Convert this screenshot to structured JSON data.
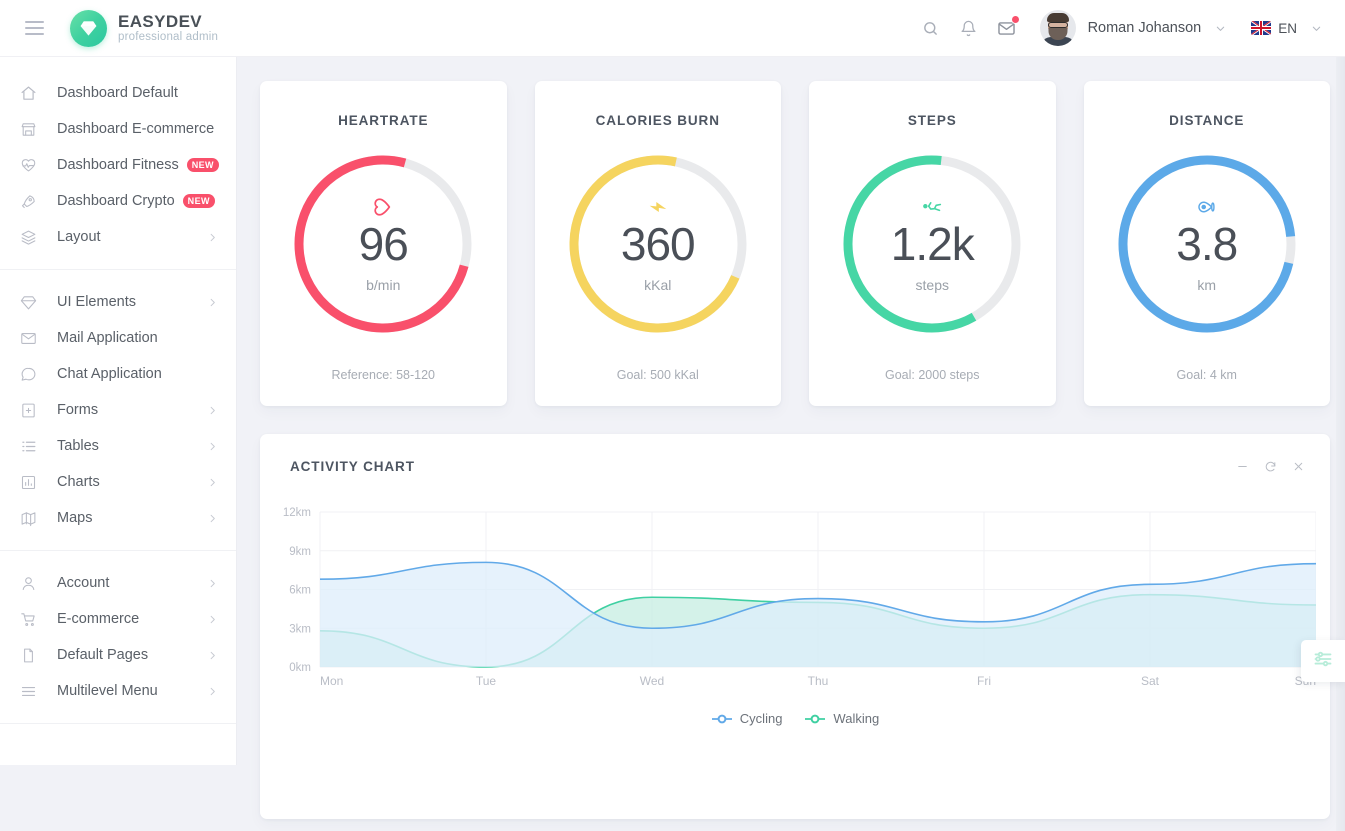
{
  "header": {
    "menu_icon": "hamburger-icon",
    "logo_icon": "diamond-icon",
    "logo_title": "EASYDEV",
    "logo_subtitle": "professional admin",
    "search_icon": "search-icon",
    "bell_icon": "bell-icon",
    "mail_icon": "envelope-icon",
    "user_name": "Roman Johanson",
    "user_chevron": "chevron-down-icon",
    "language": "EN",
    "lang_chevron": "chevron-down-icon",
    "flag": "uk-flag-icon"
  },
  "sidebar": {
    "groups": [
      {
        "items": [
          {
            "label": "Dashboard Default",
            "icon": "home-icon",
            "badge": null,
            "arrow": false
          },
          {
            "label": "Dashboard E-commerce",
            "icon": "store-icon",
            "badge": null,
            "arrow": false
          },
          {
            "label": "Dashboard Fitness",
            "icon": "heart-pulse-icon",
            "badge": "NEW",
            "arrow": false
          },
          {
            "label": "Dashboard Crypto",
            "icon": "rocket-icon",
            "badge": "NEW",
            "arrow": false
          },
          {
            "label": "Layout",
            "icon": "layers-icon",
            "badge": null,
            "arrow": true
          }
        ]
      },
      {
        "items": [
          {
            "label": "UI Elements",
            "icon": "diamond-icon",
            "badge": null,
            "arrow": true
          },
          {
            "label": "Mail Application",
            "icon": "envelope-icon",
            "badge": null,
            "arrow": false
          },
          {
            "label": "Chat Application",
            "icon": "chat-icon",
            "badge": null,
            "arrow": false
          },
          {
            "label": "Forms",
            "icon": "form-icon",
            "badge": null,
            "arrow": true
          },
          {
            "label": "Tables",
            "icon": "list-icon",
            "badge": null,
            "arrow": true
          },
          {
            "label": "Charts",
            "icon": "bar-chart-icon",
            "badge": null,
            "arrow": true
          },
          {
            "label": "Maps",
            "icon": "map-icon",
            "badge": null,
            "arrow": true
          }
        ]
      },
      {
        "items": [
          {
            "label": "Default Pages",
            "icon": "file-icon",
            "badge": null,
            "arrow": true
          },
          {
            "label": "Multilevel Menu",
            "icon": "menu-icon",
            "badge": null,
            "arrow": true
          }
        ]
      }
    ],
    "group3_pre": [
      {
        "label": "Account",
        "icon": "user-icon",
        "badge": null,
        "arrow": true
      },
      {
        "label": "E-commerce",
        "icon": "cart-icon",
        "badge": null,
        "arrow": true
      }
    ]
  },
  "stats": [
    {
      "title": "HEARTRATE",
      "value": "96",
      "unit": "b/min",
      "footer": "Reference: 58-120",
      "icon": "heart-icon",
      "color": "#f9506b",
      "track": "#e9eaec",
      "percent": 75
    },
    {
      "title": "CALORIES BURN",
      "value": "360",
      "unit": "kKal",
      "footer": "Goal: 500 kKal",
      "icon": "bolt-icon",
      "color": "#f5d45f",
      "track": "#e9eaec",
      "percent": 72
    },
    {
      "title": "STEPS",
      "value": "1.2k",
      "unit": "steps",
      "footer": "Goal: 2000 steps",
      "icon": "walk-icon",
      "color": "#46d6a5",
      "track": "#e9eaec",
      "percent": 60
    },
    {
      "title": "DISTANCE",
      "value": "3.8",
      "unit": "km",
      "footer": "Goal: 4 km",
      "icon": "pin-icon",
      "color": "#5ca9e8",
      "track": "#e9eaec",
      "percent": 95
    }
  ],
  "chart_panel": {
    "title": "ACTIVITY CHART",
    "minimize_icon": "minus-icon",
    "refresh_icon": "refresh-icon",
    "close_icon": "close-icon"
  },
  "chart_data": {
    "type": "area",
    "title": "ACTIVITY CHART",
    "xlabel": "",
    "ylabel": "",
    "categories": [
      "Mon",
      "Tue",
      "Wed",
      "Thu",
      "Fri",
      "Sat",
      "Sun"
    ],
    "ytick_labels": [
      "0km",
      "3km",
      "6km",
      "9km",
      "12km"
    ],
    "ytick_values": [
      0,
      3,
      6,
      9,
      12
    ],
    "ylim": [
      0,
      12
    ],
    "grid": true,
    "legend_position": "bottom",
    "series": [
      {
        "name": "Cycling",
        "color": "#61a9e8",
        "fill": "#ddeefb",
        "values": [
          6.8,
          8.1,
          3.0,
          5.3,
          3.5,
          6.4,
          8.0
        ]
      },
      {
        "name": "Walking",
        "color": "#3fd0a2",
        "fill": "#c6eee2",
        "values": [
          2.8,
          0.0,
          5.4,
          5.0,
          3.0,
          5.6,
          4.8
        ]
      }
    ]
  },
  "fab": {
    "icon": "sliders-icon"
  }
}
